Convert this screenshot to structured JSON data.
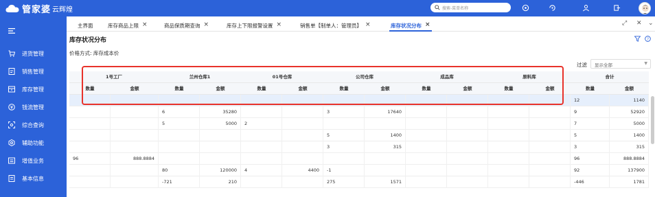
{
  "app": {
    "brand": "管家婆",
    "brand_sub": "云辉煌",
    "search_placeholder": "搜索-菜单名称"
  },
  "tabs": [
    {
      "label": "主界面",
      "closable": false,
      "active": false
    },
    {
      "label": "库存商品上限",
      "closable": true,
      "active": false
    },
    {
      "label": "商品保质期查询",
      "closable": true,
      "active": false
    },
    {
      "label": "库存上下限报警设置",
      "closable": true,
      "active": false
    },
    {
      "label": "销售单【制单人：管理员】",
      "closable": true,
      "active": false
    },
    {
      "label": "库存状况分布",
      "closable": true,
      "active": true
    }
  ],
  "sidebar": {
    "items": [
      {
        "label": "进货管理",
        "icon": "cart-icon"
      },
      {
        "label": "销售管理",
        "icon": "sales-doc-icon"
      },
      {
        "label": "库存管理",
        "icon": "warehouse-icon"
      },
      {
        "label": "钱流管理",
        "icon": "money-icon"
      },
      {
        "label": "综合查询",
        "icon": "query-icon"
      },
      {
        "label": "辅助功能",
        "icon": "gear-icon"
      },
      {
        "label": "增值业务",
        "icon": "card-icon"
      },
      {
        "label": "基本信息",
        "icon": "info-doc-icon"
      }
    ]
  },
  "page": {
    "title": "库存状况分布",
    "price_mode": "价格方式: 库存成本价",
    "filter_label": "过滤",
    "filter_value": "显示全部"
  },
  "table": {
    "groups": [
      "1号工厂",
      "兰州仓库1",
      "01号仓库",
      "公司仓库",
      "成品库",
      "原料库",
      "合计"
    ],
    "sub_headers": [
      "数量",
      "金额"
    ],
    "rows": [
      [
        "",
        "",
        "",
        "",
        "",
        "",
        "",
        "",
        "",
        "",
        "",
        "",
        "12",
        "1140"
      ],
      [
        "",
        "",
        "6",
        "35280",
        "",
        "",
        "3",
        "17640",
        "",
        "",
        "",
        "",
        "9",
        "52920"
      ],
      [
        "",
        "",
        "5",
        "5000",
        "2",
        "",
        "",
        "",
        "",
        "",
        "",
        "",
        "7",
        "5000"
      ],
      [
        "",
        "",
        "",
        "",
        "",
        "",
        "5",
        "1400",
        "",
        "",
        "",
        "",
        "5",
        "1400"
      ],
      [
        "",
        "",
        "",
        "",
        "",
        "",
        "3",
        "315",
        "",
        "",
        "",
        "",
        "3",
        "315"
      ],
      [
        "96",
        "888.8884",
        "",
        "",
        "",
        "",
        "",
        "",
        "",
        "",
        "",
        "",
        "96",
        "888.8884"
      ],
      [
        "",
        "",
        "80",
        "120000",
        "4",
        "4400",
        "-1",
        "",
        "",
        "",
        "",
        "",
        "92",
        "137900"
      ],
      [
        "",
        "",
        "-721",
        "210",
        "",
        "",
        "275",
        "1571",
        "",
        "",
        "",
        "",
        "-446",
        "1781"
      ]
    ],
    "selected_row": 0
  },
  "colors": {
    "primary": "#2c62d9",
    "highlight": "#e8322a",
    "selected_row": "#e6effc"
  }
}
